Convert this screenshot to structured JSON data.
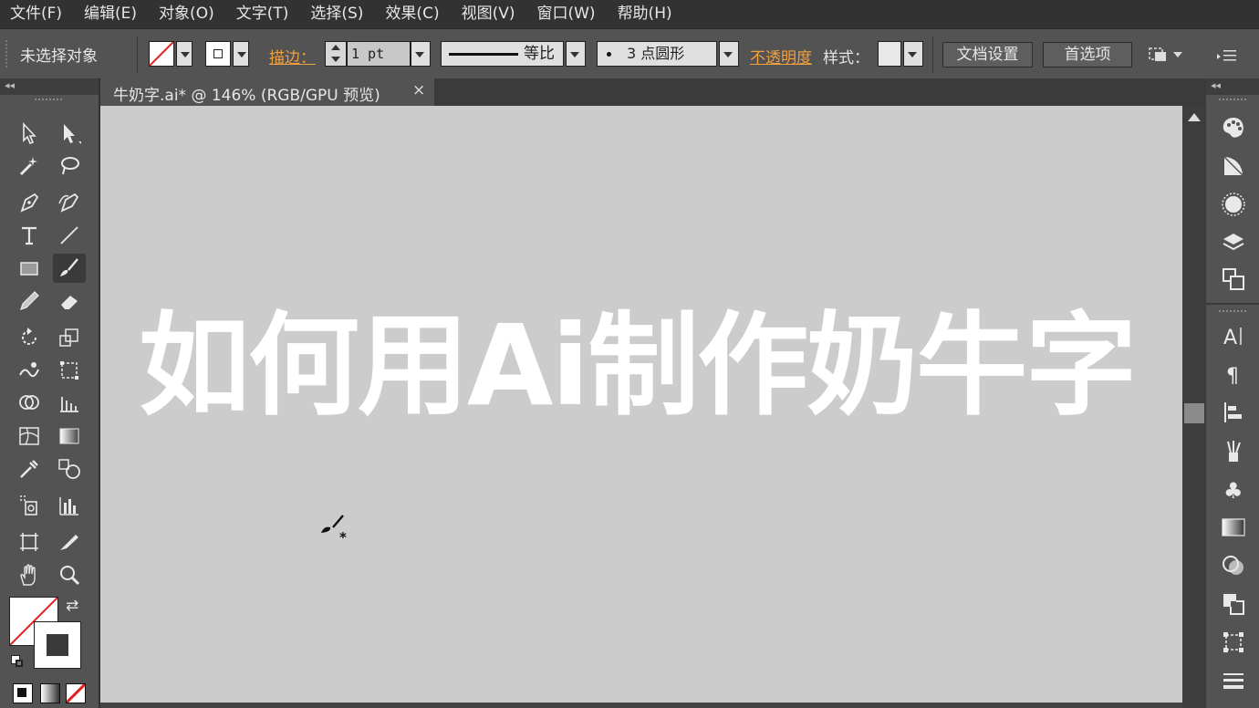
{
  "menu": [
    "文件(F)",
    "编辑(E)",
    "对象(O)",
    "文字(T)",
    "选择(S)",
    "效果(C)",
    "视图(V)",
    "窗口(W)",
    "帮助(H)"
  ],
  "control": {
    "selection_label": "未选择对象",
    "stroke_label": "描边：",
    "stroke_weight": "1 pt",
    "profile_label": "等比",
    "brush_label": "3 点圆形",
    "opacity_label": "不透明度",
    "style_label": "样式：",
    "doc_setup": "文档设置",
    "preferences": "首选项"
  },
  "document": {
    "tab_title": "牛奶字.ai* @ 146% (RGB/GPU 预览)",
    "close_glyph": "×",
    "artwork_text": "如何用Ai制作奶牛字"
  },
  "icons": {
    "left_tools": [
      "selection-tool-icon",
      "direct-selection-tool-icon",
      "magic-wand-icon",
      "lasso-icon",
      "pen-tool-icon",
      "curvature-tool-icon",
      "type-tool-icon",
      "line-tool-icon",
      "rectangle-tool-icon",
      "paintbrush-tool-icon",
      "pencil-tool-icon",
      "eraser-tool-icon",
      "rotate-tool-icon",
      "scale-tool-icon",
      "warp-tool-icon",
      "free-transform-icon",
      "shape-builder-icon",
      "perspective-grid-icon",
      "mesh-tool-icon",
      "gradient-tool-icon",
      "eyedropper-icon",
      "blend-tool-icon",
      "symbol-sprayer-icon",
      "column-graph-icon",
      "artboard-tool-icon",
      "slice-tool-icon",
      "hand-tool-icon",
      "zoom-tool-icon"
    ],
    "right_panels": [
      "color-panel-icon",
      "color-guide-icon",
      "appearance-icon",
      "layers-icon",
      "artboards-icon",
      "character-icon",
      "paragraph-icon",
      "align-icon",
      "brushes-icon",
      "symbols-icon",
      "gradient-panel-icon",
      "transparency-icon",
      "pathfinder-icon",
      "transform-icon",
      "stroke-panel-icon"
    ]
  },
  "colors": {
    "ui_dark": "#323232",
    "ui_panel": "#535353",
    "canvas": "#cccccc",
    "accent_orange": "#f0a040",
    "none_red": "#e02020"
  }
}
